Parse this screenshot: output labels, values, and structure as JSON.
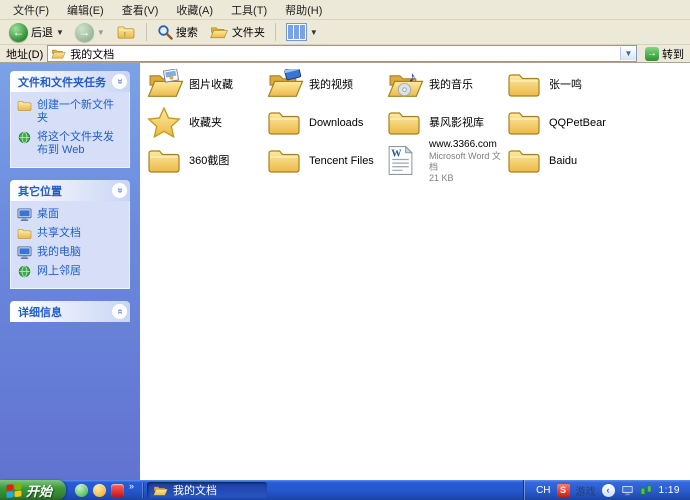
{
  "menu_bar": {
    "items": [
      "文件(F)",
      "编辑(E)",
      "查看(V)",
      "收藏(A)",
      "工具(T)",
      "帮助(H)"
    ]
  },
  "toolbar": {
    "back_label": "后退",
    "search_label": "搜索",
    "folders_label": "文件夹"
  },
  "address_bar": {
    "label": "地址(D)",
    "value": "我的文档",
    "go_label": "转到"
  },
  "sidebar": {
    "tasks_panel": {
      "title": "文件和文件夹任务",
      "items": [
        {
          "label": "创建一个新文件夹",
          "icon": "new-folder-icon"
        },
        {
          "label": "将这个文件夹发布到 Web",
          "icon": "publish-web-icon"
        }
      ]
    },
    "places_panel": {
      "title": "其它位置",
      "items": [
        {
          "label": "桌面",
          "icon": "desktop-icon"
        },
        {
          "label": "共享文档",
          "icon": "shared-documents-icon"
        },
        {
          "label": "我的电脑",
          "icon": "my-computer-icon"
        },
        {
          "label": "网上邻居",
          "icon": "network-places-icon"
        }
      ]
    },
    "details_panel": {
      "title": "详细信息"
    }
  },
  "files": [
    {
      "label": "图片收藏",
      "icon": "folder-open-pictures-icon"
    },
    {
      "label": "我的视频",
      "icon": "folder-open-video-icon"
    },
    {
      "label": "我的音乐",
      "icon": "folder-open-music-icon"
    },
    {
      "label": "张一鸣",
      "icon": "folder-icon"
    },
    {
      "label": "收藏夹",
      "icon": "favorites-star-icon"
    },
    {
      "label": "Downloads",
      "icon": "folder-icon"
    },
    {
      "label": "暴风影视库",
      "icon": "folder-icon"
    },
    {
      "label": "QQPetBear",
      "icon": "folder-icon"
    },
    {
      "label": "360截图",
      "icon": "folder-icon"
    },
    {
      "label": "Tencent Files",
      "icon": "folder-icon"
    },
    {
      "label": "www.3366.com",
      "icon": "word-document-icon",
      "type_text": "Microsoft Word 文档",
      "size_text": "21 KB"
    },
    {
      "label": "Baidu",
      "icon": "folder-icon"
    }
  ],
  "taskbar": {
    "start_label": "开始",
    "task_button_label": "我的文档",
    "tray": {
      "lang_indicator": "CH",
      "ime_badge": "S",
      "status_text": "游戏",
      "clock": "1:19"
    }
  },
  "colors": {
    "accent_blue": "#215dc6",
    "sidebar_top": "#7ba2e7",
    "sidebar_bottom": "#6173d0",
    "taskbar_blue": "#2456cd",
    "start_green": "#3c9a3c",
    "folder_yellow": "#f3cf72"
  }
}
